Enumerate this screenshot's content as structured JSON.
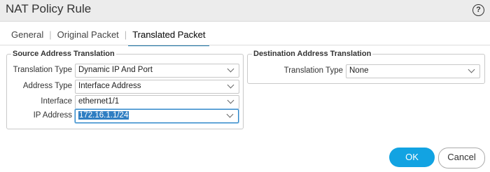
{
  "window": {
    "title": "NAT Policy Rule"
  },
  "help_icon": "help-icon",
  "tabs": [
    {
      "label": "General"
    },
    {
      "label": "Original Packet"
    },
    {
      "label": "Translated Packet",
      "active": true
    }
  ],
  "source": {
    "legend": "Source Address Translation",
    "fields": [
      {
        "label": "Translation Type",
        "value": "Dynamic IP And Port"
      },
      {
        "label": "Address Type",
        "value": "Interface Address"
      },
      {
        "label": "Interface",
        "value": "ethernet1/1"
      },
      {
        "label": "IP Address",
        "value": "172.16.1.1/24",
        "selected": true
      }
    ]
  },
  "destination": {
    "legend": "Destination Address Translation",
    "fields": [
      {
        "label": "Translation Type",
        "value": "None"
      }
    ]
  },
  "buttons": {
    "ok": "OK",
    "cancel": "Cancel"
  },
  "colors": {
    "ok_button": "#12a3e2",
    "active_tab_underline": "#1a73a8",
    "focus": "#2e86c7"
  }
}
